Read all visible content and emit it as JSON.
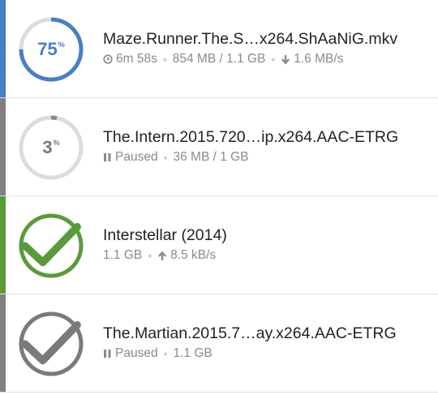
{
  "torrents": [
    {
      "name": "Maze.Runner.The.S…x264.ShAaNiG.mkv",
      "state": "downloading",
      "stripe_color": "#4a7ec6",
      "ring_color": "#4a7ec6",
      "progress": 0.75,
      "progress_number": "75",
      "progress_sign": "%",
      "eta_icon": "clock-icon",
      "eta": "6m 58s",
      "size": "854 MB / 1.1 GB",
      "rate_icon": "download-arrow-icon",
      "rate": "1.6 MB/s"
    },
    {
      "name": "The.Intern.2015.720…ip.x264.AAC-ETRG",
      "state": "paused",
      "stripe_color": "#808080",
      "ring_color": "#8a8a8a",
      "progress": 0.03,
      "progress_number": "3",
      "progress_sign": "%",
      "status_icon": "pause-icon",
      "status": "Paused",
      "size": "36 MB / 1 GB"
    },
    {
      "name": "Interstellar (2014)",
      "state": "seeding",
      "stripe_color": "#5b9a3c",
      "ring_color": "#5b9a3c",
      "progress": 1.0,
      "complete_icon": "checkmark-icon",
      "size": "1.1 GB",
      "rate_icon": "upload-arrow-icon",
      "rate": "8.5 kB/s"
    },
    {
      "name": "The.Martian.2015.7…ay.x264.AAC-ETRG",
      "state": "paused-complete",
      "stripe_color": "#808080",
      "ring_color": "#7a7a7a",
      "progress": 1.0,
      "complete_icon": "checkmark-icon",
      "status_icon": "pause-icon",
      "status": "Paused",
      "size": "1.1 GB"
    }
  ]
}
